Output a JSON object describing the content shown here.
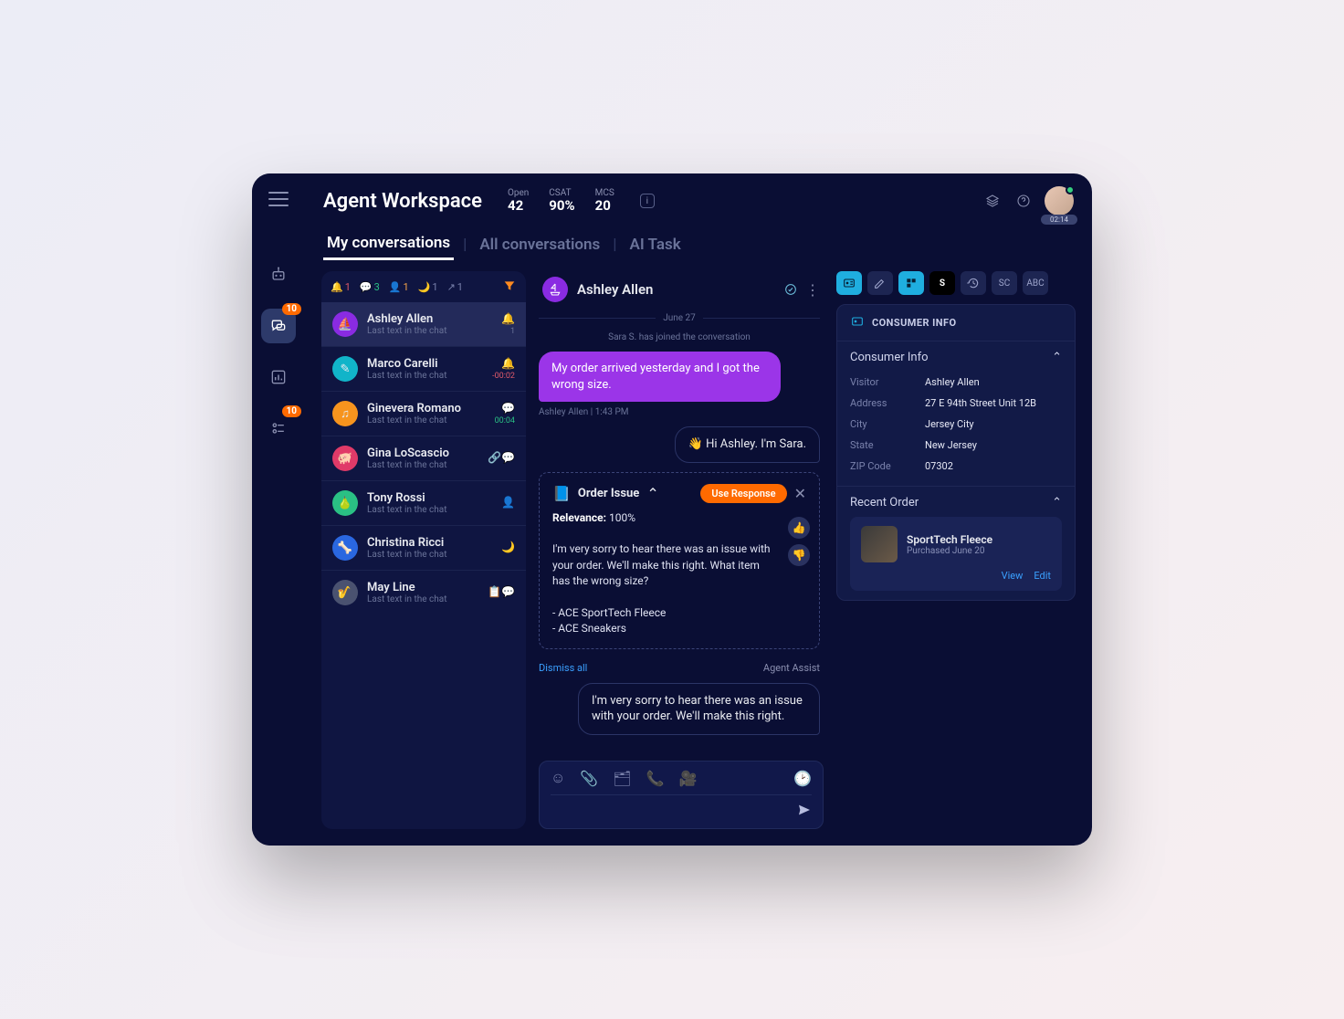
{
  "header": {
    "title": "Agent Workspace",
    "metrics": {
      "open": {
        "label": "Open",
        "value": "42"
      },
      "csat": {
        "label": "CSAT",
        "value": "90%"
      },
      "mcs": {
        "label": "MCS",
        "value": "20"
      }
    },
    "timer": "02:14"
  },
  "rail": {
    "badge1": "10",
    "badge2": "10"
  },
  "tabs": {
    "my": "My conversations",
    "all": "All conversations",
    "ai": "AI Task"
  },
  "filters": {
    "bell": "1",
    "chat": "3",
    "person": "1",
    "moon": "1",
    "transfer": "1"
  },
  "conversations": [
    {
      "name": "Ashley Allen",
      "sub": "Last text in the chat",
      "avatarColor": "#8a2be2",
      "icon": "boat",
      "rightIcon": "bell",
      "rightIconColor": "#e05a6a",
      "time": "1"
    },
    {
      "name": "Marco Carelli",
      "sub": "Last text in the chat",
      "avatarColor": "#11b4c9",
      "icon": "pen",
      "rightIcon": "bell",
      "rightIconColor": "#e05a6a",
      "time": "-00:02",
      "timeClass": "red"
    },
    {
      "name": "Ginevera Romano",
      "sub": "Last text in the chat",
      "avatarColor": "#f7941e",
      "icon": "music",
      "rightIcon": "chat",
      "rightIconColor": "#2ac084",
      "time": "00:04",
      "timeClass": "green"
    },
    {
      "name": "Gina LoScascio",
      "sub": "Last text in the chat",
      "avatarColor": "#e03a68",
      "icon": "pig",
      "rightIcon": "link-chat",
      "rightIconColor": "#ffc94a",
      "time": ""
    },
    {
      "name": "Tony Rossi",
      "sub": "Last text in the chat",
      "avatarColor": "#2ac084",
      "icon": "pear",
      "rightIcon": "person",
      "rightIconColor": "#f7a54a",
      "time": ""
    },
    {
      "name": "Christina Ricci",
      "sub": "Last text in the chat",
      "avatarColor": "#2a67e0",
      "icon": "bone",
      "rightIcon": "moon",
      "rightIconColor": "#7a82ac",
      "time": ""
    },
    {
      "name": "May Line",
      "sub": "Last text in the chat",
      "avatarColor": "#4a5270",
      "icon": "sax",
      "rightIcon": "copy-chat",
      "rightIconColor": "#7a82ac",
      "time": ""
    }
  ],
  "chat": {
    "name": "Ashley Allen",
    "date": "June 27",
    "system": "Sara S. has joined the conversation",
    "visitorMsg": "My order arrived yesterday and I got the wrong size.",
    "visitorMeta": "Ashley Allen  |  1:43 PM",
    "agentMsg1": "👋 Hi Ashley. I'm Sara.",
    "agentMsg2": "I'm very sorry to hear there was an issue with your order. We'll make this right."
  },
  "suggest": {
    "title": "Order Issue",
    "cta": "Use Response",
    "relevanceLabel": "Relevance:",
    "relevanceValue": "100%",
    "body": "I'm very sorry to hear there was an issue with your order. We'll make this right. What item has the wrong size?",
    "item1": "- ACE SportTech Fleece",
    "item2": "- ACE Sneakers",
    "dismiss": "Dismiss all",
    "assist": "Agent Assist"
  },
  "sideChips": {
    "sc": "SC",
    "abc": "ABC"
  },
  "consumer": {
    "panelTitle": "CONSUMER INFO",
    "section": "Consumer Info",
    "visitor": {
      "k": "Visitor",
      "v": "Ashley Allen"
    },
    "address": {
      "k": "Address",
      "v": "27 E 94th Street Unit 12B"
    },
    "city": {
      "k": "City",
      "v": "Jersey City"
    },
    "state": {
      "k": "State",
      "v": "New Jersey"
    },
    "zip": {
      "k": "ZIP Code",
      "v": "07302"
    }
  },
  "order": {
    "section": "Recent Order",
    "title": "SportTech Fleece",
    "sub": "Purchased June 20",
    "view": "View",
    "edit": "Edit"
  }
}
